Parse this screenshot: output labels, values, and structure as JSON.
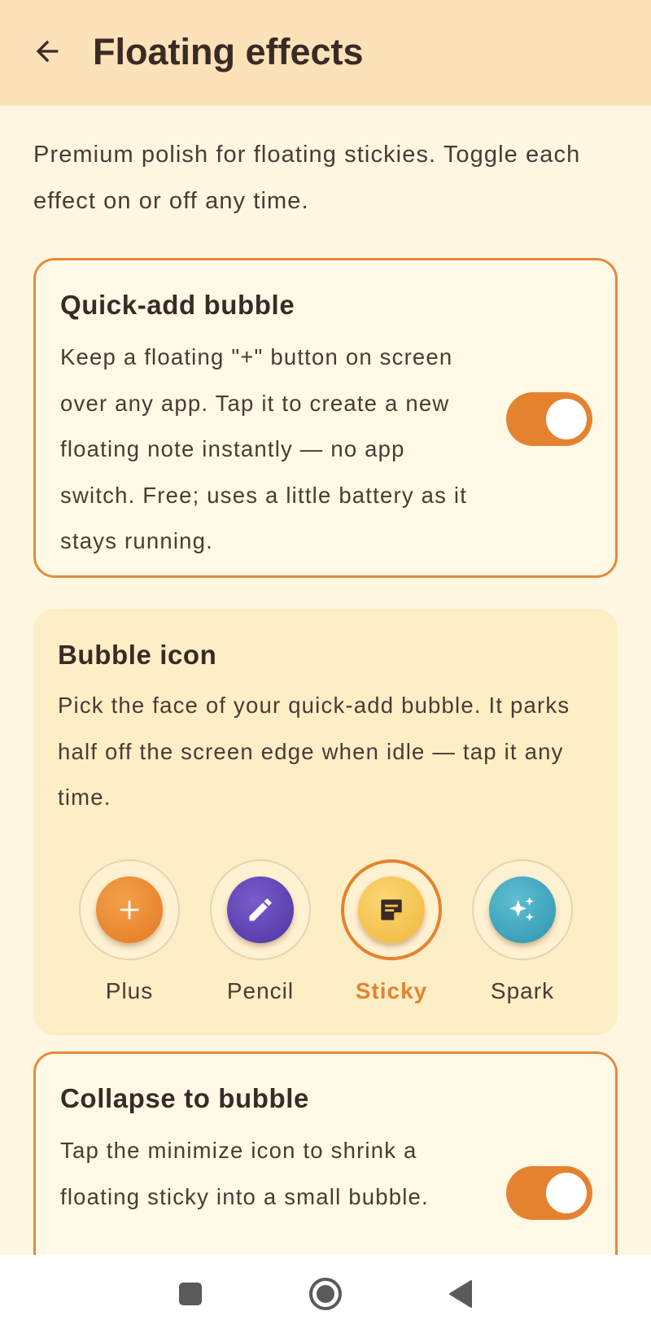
{
  "header": {
    "title": "Floating effects",
    "back_icon": "arrow-left-icon"
  },
  "intro": "Premium polish for floating stickies. Toggle each effect on or off any time.",
  "quick_add": {
    "title": "Quick-add bubble",
    "description": "Keep a floating \"+\" button on screen over any app. Tap it to create a new floating note instantly — no app switch. Free; uses a little battery as it stays running.",
    "enabled": true
  },
  "bubble_icon": {
    "title": "Bubble icon",
    "description": "Pick the face of your quick-add bubble. It parks half off the screen edge when idle — tap it any time.",
    "options": [
      {
        "label": "Plus",
        "icon": "plus-icon",
        "color": "#E9842E",
        "selected": false
      },
      {
        "label": "Pencil",
        "icon": "pencil-icon",
        "color": "#5A3EB0",
        "selected": false
      },
      {
        "label": "Sticky",
        "icon": "sticky-note-icon",
        "color": "#F3C24A",
        "selected": true
      },
      {
        "label": "Spark",
        "icon": "sparkle-icon",
        "color": "#3FA6BE",
        "selected": false
      }
    ]
  },
  "collapse": {
    "title": "Collapse to bubble",
    "description": "Tap the minimize icon to shrink a floating sticky into a small bubble.",
    "enabled": true
  },
  "nav": {
    "recents_icon": "square-icon",
    "home_icon": "circle-icon",
    "back_icon": "triangle-back-icon"
  },
  "colors": {
    "accent": "#E58230",
    "appbar_bg": "#FBE2B8",
    "page_bg": "#FFF7E1"
  }
}
